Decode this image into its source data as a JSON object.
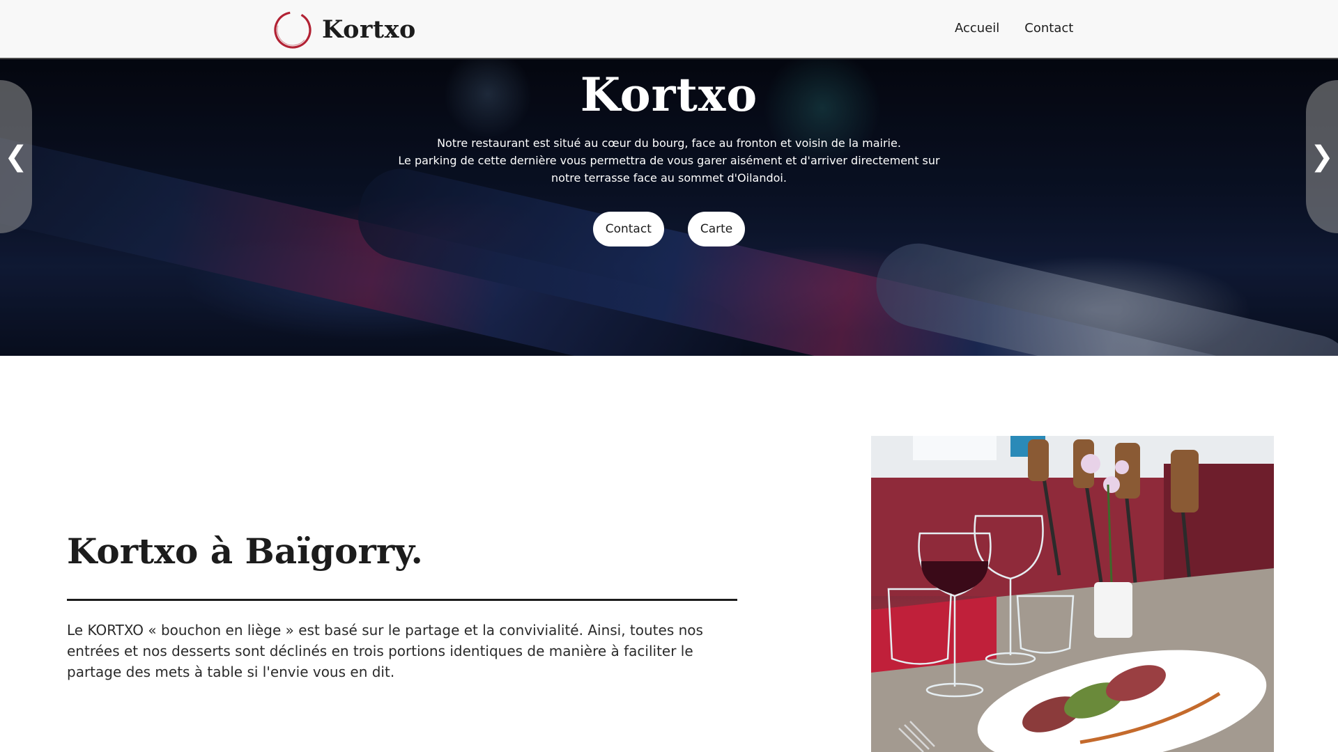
{
  "header": {
    "logo_text": "Kortxo",
    "nav": [
      {
        "label": "Accueil"
      },
      {
        "label": "Contact"
      }
    ]
  },
  "hero": {
    "title": "Kortxo",
    "lines": [
      "Notre restaurant est situé au cœur du bourg, face au fronton et voisin de la mairie.",
      "Le parking de cette dernière vous permettra de vous garer aisément et d'arriver directement sur notre terrasse face au sommet d'Oilandoi."
    ],
    "buttons": [
      {
        "label": "Contact"
      },
      {
        "label": "Carte"
      }
    ],
    "prev_arrow": "❮",
    "next_arrow": "❯"
  },
  "about": {
    "title": "Kortxo à Baïgorry.",
    "text": "Le KORTXO « bouchon en liège » est basé sur le partage et la convivialité. Ainsi, toutes nos entrées et nos desserts sont déclinés en trois portions identiques de manière à faciliter le partage des mets à table si l'envie vous en dit."
  },
  "colors": {
    "accent": "#b22234",
    "header_bg": "#f8f8f8",
    "text": "#1c1c1c"
  },
  "icons": {
    "logo": "cork-ring-logo-icon",
    "prev": "chevron-left-icon",
    "next": "chevron-right-icon"
  }
}
